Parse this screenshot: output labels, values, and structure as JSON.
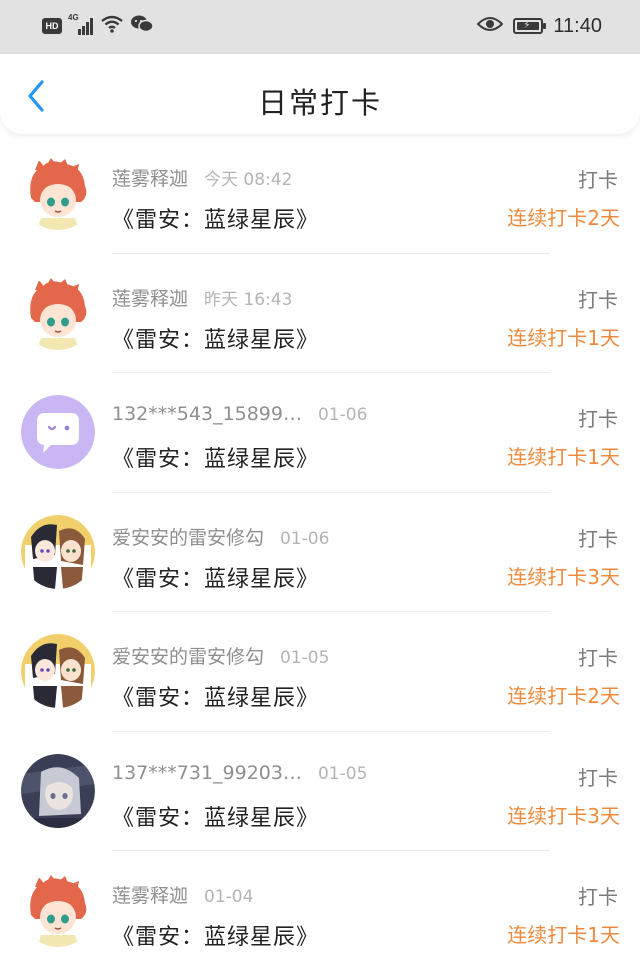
{
  "status_bar": {
    "hd": "HD",
    "network": "4G",
    "time": "11:40"
  },
  "header": {
    "title": "日常打卡"
  },
  "items": [
    {
      "username": "莲雾释迦",
      "timestamp": "今天 08:42",
      "book": "《雷安：蓝绿星辰》",
      "action": "打卡",
      "streak": "连续打卡2天",
      "avatar": "redhead-anime-avatar"
    },
    {
      "username": "莲雾释迦",
      "timestamp": "昨天 16:43",
      "book": "《雷安：蓝绿星辰》",
      "action": "打卡",
      "streak": "连续打卡1天",
      "avatar": "redhead-anime-avatar"
    },
    {
      "username": "132***543_15899…",
      "timestamp": "01-06",
      "book": "《雷安：蓝绿星辰》",
      "action": "打卡",
      "streak": "连续打卡1天",
      "avatar": "purple-chat-bubble-avatar"
    },
    {
      "username": "爱安安的雷安修勾",
      "timestamp": "01-06",
      "book": "《雷安：蓝绿星辰》",
      "action": "打卡",
      "streak": "连续打卡3天",
      "avatar": "duo-anime-avatar"
    },
    {
      "username": "爱安安的雷安修勾",
      "timestamp": "01-05",
      "book": "《雷安：蓝绿星辰》",
      "action": "打卡",
      "streak": "连续打卡2天",
      "avatar": "duo-anime-avatar"
    },
    {
      "username": "137***731_99203…",
      "timestamp": "01-05",
      "book": "《雷安：蓝绿星辰》",
      "action": "打卡",
      "streak": "连续打卡3天",
      "avatar": "dark-anime-avatar"
    },
    {
      "username": "莲雾释迦",
      "timestamp": "01-04",
      "book": "《雷安：蓝绿星辰》",
      "action": "打卡",
      "streak": "连续打卡1天",
      "avatar": "redhead-anime-avatar"
    }
  ],
  "colors": {
    "accent_blue": "#2196f3",
    "streak_orange": "#ee8a3d",
    "status_bar_bg": "#e2e2e2"
  }
}
